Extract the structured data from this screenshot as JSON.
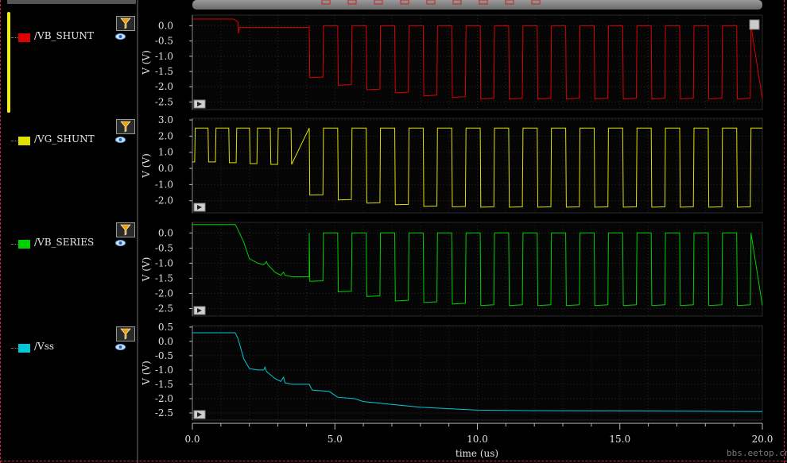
{
  "signals": [
    {
      "name": "/VB_SHUNT",
      "color": "#e00000"
    },
    {
      "name": "/VG_SHUNT",
      "color": "#e0e000"
    },
    {
      "name": "/VB_SERIES",
      "color": "#00d000"
    },
    {
      "name": "/Vss",
      "color": "#00c8d8"
    }
  ],
  "icons": {
    "filter": "filter-icon",
    "visibility": "eye-icon",
    "expand": "play-arrow-icon",
    "fit": "zoom-fit-icon"
  },
  "watermark": "bbs.eetop.cn",
  "chart_data": [
    {
      "type": "line",
      "series": [
        {
          "name": "/VB_SHUNT",
          "color": "#e00000"
        }
      ],
      "ylabel": "V (V)",
      "ylim": [
        -2.75,
        0.35
      ],
      "yticks": [
        "0.0",
        "-0.5",
        "-1.0",
        "-1.5",
        "-2.0",
        "-2.5"
      ],
      "xlim": [
        0,
        20
      ],
      "shape": "square",
      "high": [
        0.22,
        0.0
      ],
      "lows": [
        -1.7,
        -1.95,
        -2.1,
        -2.2,
        -2.3,
        -2.35,
        -2.4,
        -2.4,
        -2.4,
        -2.4,
        -2.4,
        -2.4,
        -2.4,
        -2.4,
        -2.4,
        -2.4
      ],
      "pulse_start_us": 4.1,
      "period_us": 1.0,
      "pre": [
        [
          0,
          0.22
        ],
        [
          1.45,
          0.22
        ],
        [
          1.6,
          0.12
        ],
        [
          1.62,
          -0.25
        ],
        [
          1.65,
          -0.05
        ],
        [
          4.1,
          -0.05
        ]
      ]
    },
    {
      "type": "line",
      "series": [
        {
          "name": "/VG_SHUNT",
          "color": "#e0e000"
        }
      ],
      "ylabel": "V (V)",
      "ylim": [
        -2.75,
        3.1
      ],
      "yticks": [
        "3.0",
        "2.0",
        "1.0",
        "0.0",
        "-1.0",
        "-2.0"
      ],
      "xlim": [
        0,
        20
      ],
      "shape": "square",
      "high": [
        2.5,
        2.5
      ],
      "lows": [
        -1.65,
        -1.95,
        -2.15,
        -2.25,
        -2.35,
        -2.38,
        -2.4,
        -2.4,
        -2.4,
        -2.4,
        -2.4,
        -2.4,
        -2.4,
        -2.4,
        -2.4,
        -2.4
      ],
      "pulse_start_us": 4.1,
      "period_us": 1.0,
      "pre_lows": [
        0.4,
        0.4,
        0.35,
        0.3,
        0.25
      ]
    },
    {
      "type": "line",
      "series": [
        {
          "name": "/VB_SERIES",
          "color": "#00d000"
        }
      ],
      "ylabel": "V (V)",
      "ylim": [
        -2.75,
        0.35
      ],
      "yticks": [
        "0.0",
        "-0.5",
        "-1.0",
        "-1.5",
        "-2.0",
        "-2.5"
      ],
      "xlim": [
        0,
        20
      ],
      "shape": "square",
      "high": [
        0.0,
        0.0
      ],
      "lows": [
        -1.6,
        -1.95,
        -2.1,
        -2.25,
        -2.3,
        -2.35,
        -2.4,
        -2.4,
        -2.4,
        -2.4,
        -2.4,
        -2.4,
        -2.4,
        -2.4,
        -2.4,
        -2.4
      ],
      "pulse_start_us": 4.1,
      "period_us": 1.0,
      "pre": [
        [
          0,
          0.28
        ],
        [
          1.5,
          0.28
        ],
        [
          1.55,
          0.2
        ],
        [
          1.8,
          -0.3
        ],
        [
          2.0,
          -0.85
        ],
        [
          2.3,
          -1.0
        ],
        [
          2.5,
          -1.05
        ],
        [
          2.6,
          -0.95
        ],
        [
          2.65,
          -1.05
        ],
        [
          2.9,
          -1.3
        ],
        [
          3.1,
          -1.4
        ],
        [
          3.2,
          -1.3
        ],
        [
          3.25,
          -1.4
        ],
        [
          3.5,
          -1.45
        ],
        [
          4.1,
          -1.45
        ]
      ]
    },
    {
      "type": "line",
      "series": [
        {
          "name": "/Vss",
          "color": "#00c8d8"
        }
      ],
      "ylabel": "V (V)",
      "ylim": [
        -2.75,
        0.55
      ],
      "yticks": [
        "0.5",
        "0.0",
        "-0.5",
        "-1.0",
        "-1.5",
        "-2.0",
        "-2.5"
      ],
      "xlim": [
        0,
        20
      ],
      "xticks": [
        "0.0",
        "5.0",
        "10.0",
        "15.0",
        "20.0"
      ],
      "xlabel": "time (us)",
      "points": [
        [
          0,
          0.3
        ],
        [
          1.5,
          0.3
        ],
        [
          1.6,
          0.1
        ],
        [
          1.8,
          -0.6
        ],
        [
          2.0,
          -0.95
        ],
        [
          2.3,
          -1.0
        ],
        [
          2.5,
          -1.0
        ],
        [
          2.55,
          -0.9
        ],
        [
          2.6,
          -1.05
        ],
        [
          2.9,
          -1.3
        ],
        [
          3.1,
          -1.4
        ],
        [
          3.2,
          -1.25
        ],
        [
          3.25,
          -1.45
        ],
        [
          3.5,
          -1.5
        ],
        [
          4.1,
          -1.5
        ],
        [
          4.2,
          -1.7
        ],
        [
          4.8,
          -1.75
        ],
        [
          5.1,
          -1.95
        ],
        [
          5.7,
          -2.0
        ],
        [
          6.0,
          -2.1
        ],
        [
          6.5,
          -2.15
        ],
        [
          7.0,
          -2.2
        ],
        [
          7.5,
          -2.25
        ],
        [
          8.0,
          -2.3
        ],
        [
          9.0,
          -2.35
        ],
        [
          10.0,
          -2.4
        ],
        [
          12.0,
          -2.42
        ],
        [
          15.0,
          -2.43
        ],
        [
          20.0,
          -2.45
        ]
      ]
    }
  ]
}
